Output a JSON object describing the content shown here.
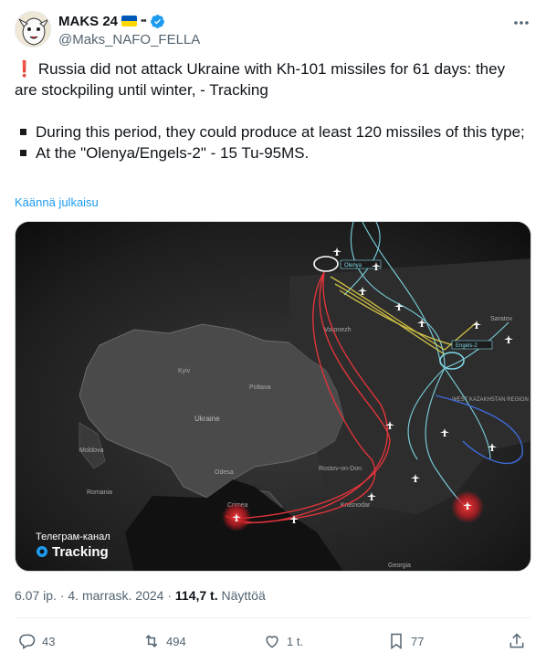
{
  "author": {
    "display_name": "MAKS 24",
    "handle": "@Maks_NAFO_FELLA",
    "eyes": "••"
  },
  "tweet": {
    "line1": "Russia did not attack Ukraine with Kh-101 missiles for 61 days: they are stockpiling until winter, - Tracking",
    "line2": "During this period, they could produce at least 120 missiles of this type;",
    "line3": "At the \"Olenya/Engels-2\" - 15 Tu-95MS.",
    "translate": "Käännä julkaisu"
  },
  "media": {
    "watermark_top": "Телеграм-канал",
    "watermark_brand": "Tracking",
    "map_labels": {
      "ukraine": "Ukraine",
      "kyiv": "Kyiv",
      "poltava": "Poltava",
      "odesa": "Odesa",
      "moldova": "Moldova",
      "romania": "Romania",
      "crimea": "Crimea",
      "rostov": "Rostov-on-Don",
      "krasnodar": "Krasnodar",
      "georgia": "Georgia",
      "voronezh": "Voronezh",
      "saratov": "Saratov",
      "kazakhstan": "WEST KAZAKHSTAN REGION",
      "engels_tag": "Engels-2",
      "olenya_tag": "Olenya"
    }
  },
  "meta": {
    "time": "6.07 ip.",
    "date": "4. marrask. 2024",
    "views": "114,7 t.",
    "views_label": "Näyttöä"
  },
  "actions": {
    "replies": "43",
    "reposts": "494",
    "likes": "1 t.",
    "bookmarks": "77"
  },
  "colors": {
    "link": "#1d9bf0",
    "verified": "#1d9bf0",
    "route_red": "#e0343a",
    "route_yellow": "#e8d84a",
    "route_cyan": "#7fd8e6"
  }
}
